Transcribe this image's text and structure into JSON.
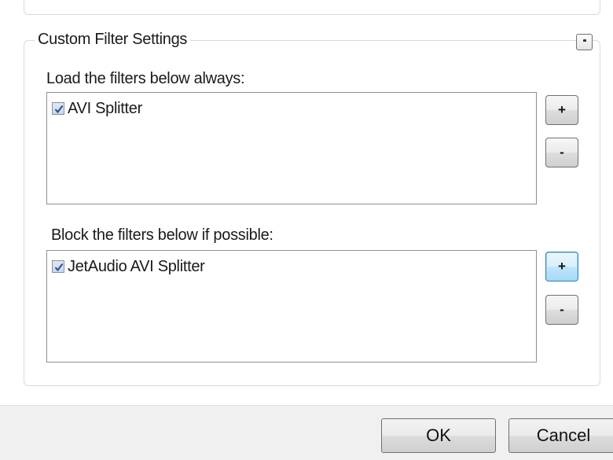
{
  "group": {
    "title": "Custom Filter Settings"
  },
  "always": {
    "label": "Load the filters below always:",
    "items": [
      {
        "label": "AVI Splitter",
        "checked": true
      }
    ],
    "add_label": "+",
    "remove_label": "-"
  },
  "block": {
    "label": "Block the filters below if possible:",
    "items": [
      {
        "label": "JetAudio AVI Splitter",
        "checked": true
      }
    ],
    "add_label": "+",
    "remove_label": "-"
  },
  "footer": {
    "ok_label": "OK",
    "cancel_label": "Cancel"
  },
  "colors": {
    "accent": "#3c7fb1",
    "checkbox_fill": "#c7d8ee",
    "footer_bg": "#f0f0f0"
  },
  "icons": {
    "check": "checkmark-icon",
    "collapse": "collapse-icon"
  }
}
